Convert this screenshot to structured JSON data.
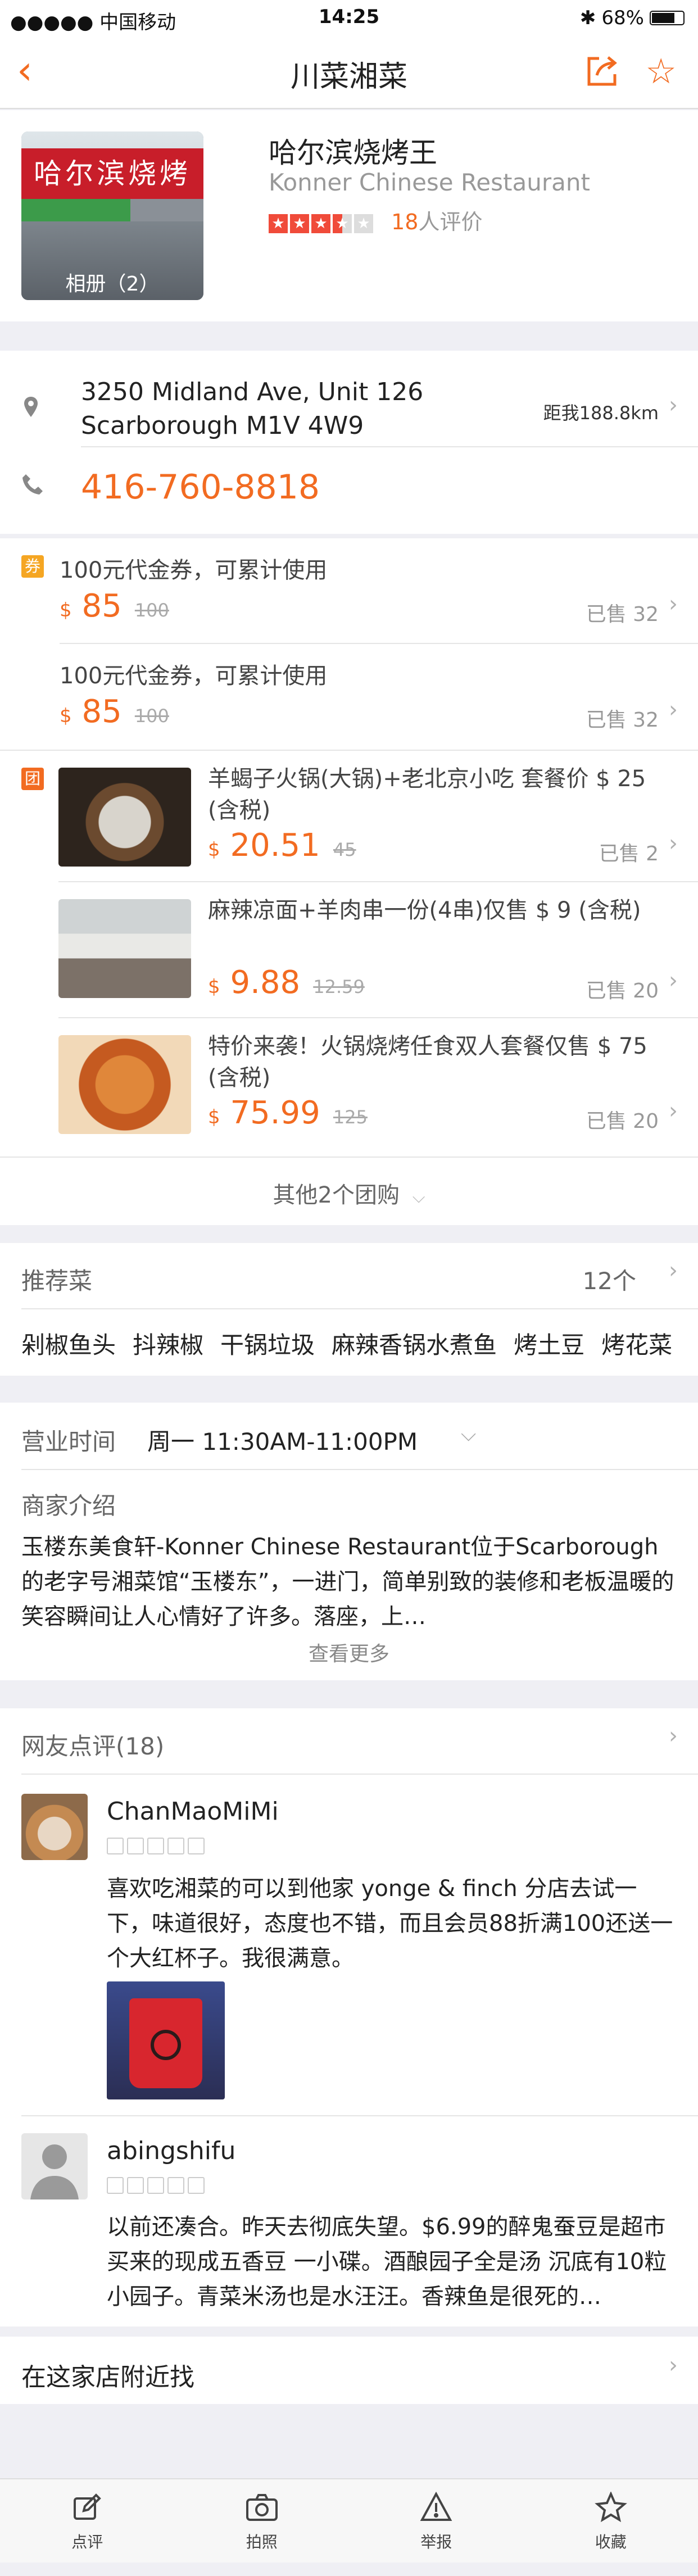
{
  "status": {
    "carrier": "●●●●● 中国移动",
    "time": "14:25",
    "battery": "68%"
  },
  "nav": {
    "title": "川菜湘菜"
  },
  "shop": {
    "name_cn": "哈尔滨烧烤王",
    "name_en": "Konner Chinese Restaurant",
    "review_count": "18",
    "review_suffix": "人评价",
    "rating": 3.5,
    "album": "相册（2）",
    "sign_text": "哈尔滨烧烤王"
  },
  "address": {
    "line1": "3250 Midland Ave, Unit 126",
    "line2": "Scarborough M1V 4W9",
    "distance": "距我188.8km"
  },
  "phone": "416-760-8818",
  "coupons": {
    "badge": "券",
    "items": [
      {
        "title": "100元代金券，可累计使用",
        "currency": "$",
        "price": "85",
        "orig": "100",
        "sold": "已售 32"
      },
      {
        "title": "100元代金券，可累计使用",
        "currency": "$",
        "price": "85",
        "orig": "100",
        "sold": "已售 32"
      }
    ]
  },
  "groups": {
    "badge": "团",
    "items": [
      {
        "title": "羊蝎子火锅(大锅)+老北京小吃 套餐价 $ 25 (含税)",
        "currency": "$",
        "price": "20.51",
        "orig": "45",
        "sold": "已售 2"
      },
      {
        "title": "麻辣凉面+羊肉串一份(4串)仅售 $ 9 (含税)",
        "currency": "$",
        "price": "9.88",
        "orig": "12.59",
        "sold": "已售 20"
      },
      {
        "title": "特价来袭！火锅烧烤任食双人套餐仅售 $ 75 (含税)",
        "currency": "$",
        "price": "75.99",
        "orig": "125",
        "sold": "已售 20"
      }
    ],
    "more": "其他2个团购"
  },
  "dishes": {
    "label": "推荐菜",
    "count": "12个",
    "items": [
      "剁椒鱼头",
      "抖辣椒",
      "干锅垃圾",
      "麻辣香锅水煮鱼",
      "烤土豆",
      "烤花菜"
    ]
  },
  "hours": {
    "label": "营业时间",
    "value": "周一  11:30AM-11:00PM"
  },
  "intro": {
    "label": "商家介绍",
    "text": "玉楼东美食轩-Konner Chinese Restaurant位于Scarborough的老字号湘菜馆“玉楼东”，一进门，简单别致的装修和老板温暖的笑容瞬间让人心情好了许多。落座，上…",
    "more": "查看更多"
  },
  "reviews": {
    "label": "网友点评(18)",
    "items": [
      {
        "user": "ChanMaoMiMi",
        "text": "喜欢吃湘菜的可以到他家 yonge & finch 分店去试一下，味道很好，态度也不错，而且会员88折满100还送一个大红杯子。我很满意。"
      },
      {
        "user": "abingshifu",
        "text": "以前还凑合。昨天去彻底失望。$6.99的醉鬼蚕豆是超市买来的现成五香豆 一小碟。酒酿园子全是汤 沉底有10粒小园子。青菜米汤也是水汪汪。香辣鱼是很死的…"
      }
    ]
  },
  "nearby": {
    "label": "在这家店附近找"
  },
  "tabs": [
    {
      "icon": "edit-icon",
      "label": "点评"
    },
    {
      "icon": "camera-icon",
      "label": "拍照"
    },
    {
      "icon": "warning-icon",
      "label": "举报"
    },
    {
      "icon": "star-icon",
      "label": "收藏"
    }
  ],
  "colors": {
    "accent": "#f26b21",
    "star": "#f04b3a",
    "coupon_badge": "#f5a623",
    "group_badge": "#f26b21"
  }
}
